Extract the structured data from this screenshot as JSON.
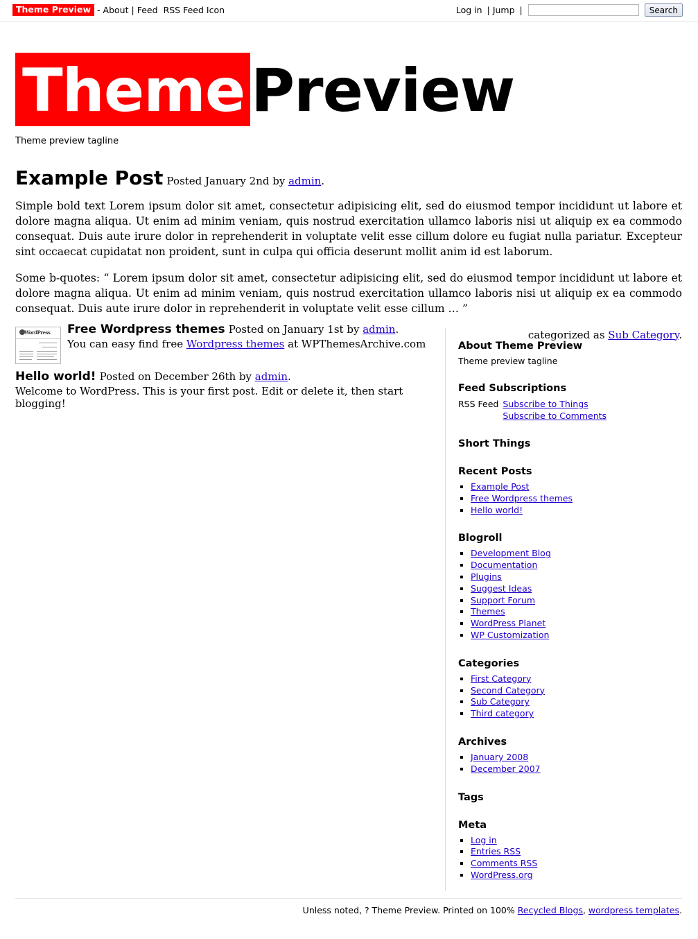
{
  "topbar": {
    "brand_chip": "Theme Preview",
    "dash": "-",
    "about_label": "About",
    "pipe": "|",
    "feed_label": "Feed",
    "rss_feed_icon_label": "RSS Feed Icon",
    "login_label": "Log in",
    "jump_label": "Jump",
    "search_value": "",
    "search_placeholder": "",
    "search_button_label": "Search"
  },
  "header": {
    "logo_part_red": "Theme",
    "logo_part_black": "Preview",
    "tagline": "Theme preview tagline"
  },
  "featured_post": {
    "title": "Example Post",
    "meta_prefix": "Posted January 2nd by",
    "author": "admin",
    "meta_suffix": ".",
    "body_paragraph_1": "Simple bold text Lorem ipsum dolor sit amet, consectetur adipisicing elit, sed do eiusmod tempor incididunt ut labore et dolore magna aliqua. Ut enim ad minim veniam, quis nostrud exercitation ullamco laboris nisi ut aliquip ex ea commodo consequat. Duis aute irure dolor in reprehenderit in voluptate velit esse cillum dolore eu fugiat nulla pariatur. Excepteur sint occaecat cupidatat non proident, sunt in culpa qui officia deserunt mollit anim id est laborum.",
    "body_paragraph_2": "Some b-quotes: “ Lorem ipsum dolor sit amet, consectetur adipisicing elit, sed do eiusmod tempor incididunt ut labore et dolore magna aliqua. Ut enim ad minim veniam, quis nostrud exercitation ullamco laboris nisi ut aliquip ex ea commodo consequat. Duis aute irure dolor in reprehenderit in voluptate velit esse cillum … ”",
    "categorized_prefix": "categorized as",
    "category_link": "Sub Category",
    "categorized_suffix": "."
  },
  "posts": [
    {
      "title": "Free Wordpress themes",
      "meta_prefix": "Posted on January 1st by",
      "author": "admin",
      "meta_suffix": ".",
      "excerpt_prefix": "You can easy find free",
      "excerpt_link": "Wordpress themes",
      "excerpt_suffix": "at WPThemesArchive.com",
      "thumbnail_caption": "WordPress"
    },
    {
      "title": "Hello world!",
      "meta_prefix": "Posted on December 26th by",
      "author": "admin",
      "meta_suffix": ".",
      "excerpt": "Welcome to WordPress. This is your first post. Edit or delete it, then start blogging!"
    }
  ],
  "sidebar": {
    "about": {
      "heading": "About Theme Preview",
      "text": "Theme preview tagline"
    },
    "feeds": {
      "heading": "Feed Subscriptions",
      "rss_label": "RSS Feed",
      "links": [
        "Subscribe to Things",
        "Subscribe to Comments"
      ]
    },
    "short_things": {
      "heading": "Short Things"
    },
    "recent_posts": {
      "heading": "Recent Posts",
      "items": [
        "Example Post",
        "Free Wordpress themes",
        "Hello world!"
      ]
    },
    "blogroll": {
      "heading": "Blogroll",
      "items": [
        "Development Blog",
        "Documentation",
        "Plugins",
        "Suggest Ideas",
        "Support Forum",
        "Themes",
        "WordPress Planet",
        "WP Customization"
      ]
    },
    "categories": {
      "heading": "Categories",
      "items": [
        "First Category",
        "Second Category",
        "Sub Category",
        "Third category"
      ]
    },
    "archives": {
      "heading": "Archives",
      "items": [
        "January 2008",
        "December 2007"
      ]
    },
    "tags": {
      "heading": "Tags"
    },
    "meta": {
      "heading": "Meta",
      "items": [
        "Log in",
        "Entries RSS",
        "Comments RSS",
        "WordPress.org"
      ]
    }
  },
  "footer": {
    "text_before": "Unless noted, ? Theme Preview. Printed on 100%",
    "link_1": "Recycled Blogs",
    "comma": ",",
    "link_2": "wordpress templates",
    "period": "."
  },
  "colors": {
    "brand_red": "#fe0000",
    "link_blue": "#2200cc",
    "border_gray": "#dcdcdc"
  }
}
